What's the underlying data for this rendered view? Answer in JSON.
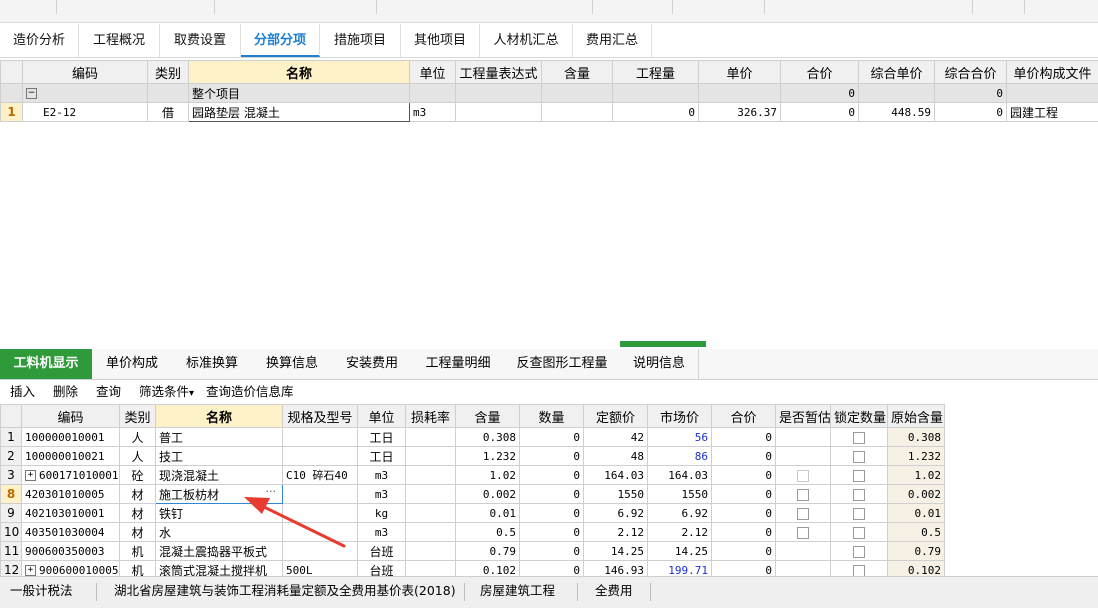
{
  "top_tabs": [
    {
      "label": "造价分析",
      "active": false
    },
    {
      "label": "工程概况",
      "active": false
    },
    {
      "label": "取费设置",
      "active": false
    },
    {
      "label": "分部分项",
      "active": true
    },
    {
      "label": "措施项目",
      "active": false
    },
    {
      "label": "其他项目",
      "active": false
    },
    {
      "label": "人材机汇总",
      "active": false
    },
    {
      "label": "费用汇总",
      "active": false
    }
  ],
  "upper_grid": {
    "columns": [
      "编码",
      "类别",
      "名称",
      "单位",
      "工程量表达式",
      "含量",
      "工程量",
      "单价",
      "合价",
      "综合单价",
      "综合合价",
      "单价构成文件"
    ],
    "group_row": {
      "collapse_symbol": "−",
      "name": "整个项目",
      "hejia": "0",
      "zonghe_hejia": "0"
    },
    "rows": [
      {
        "index": "1",
        "code": "E2-12",
        "type": "借",
        "name": "园路垫层 混凝土",
        "unit": "m3",
        "expr": "",
        "content": "",
        "quantity": "0",
        "price": "326.37",
        "total": "0",
        "comp_price": "448.59",
        "comp_total": "0",
        "file": "园建工程"
      }
    ]
  },
  "bottom_tabs": [
    {
      "label": "工料机显示",
      "active": true
    },
    {
      "label": "单价构成",
      "active": false
    },
    {
      "label": "标准换算",
      "active": false
    },
    {
      "label": "换算信息",
      "active": false
    },
    {
      "label": "安装费用",
      "active": false
    },
    {
      "label": "工程量明细",
      "active": false
    },
    {
      "label": "反查图形工程量",
      "active": false
    },
    {
      "label": "说明信息",
      "active": false
    }
  ],
  "toolbar": {
    "insert": "插入",
    "delete": "删除",
    "query": "查询",
    "filter": "筛选条件",
    "filter_arrow": "▾",
    "query_price": "查询造价信息库"
  },
  "lower_grid": {
    "columns": [
      "编码",
      "类别",
      "名称",
      "规格及型号",
      "单位",
      "损耗率",
      "含量",
      "数量",
      "定额价",
      "市场价",
      "合价",
      "是否暂估",
      "锁定数量",
      "原始含量"
    ],
    "ellipsis": "···",
    "rows": [
      {
        "index": "1",
        "code": "100000010001",
        "type": "人",
        "name": "普工",
        "spec": "",
        "unit": "工日",
        "loss": "",
        "content": "0.308",
        "qty": "0",
        "fixed": "42",
        "market": "56",
        "market_blue": true,
        "total": "0",
        "temp": "",
        "lock": true,
        "orig": "0.308"
      },
      {
        "index": "2",
        "code": "100000010021",
        "type": "人",
        "name": "技工",
        "spec": "",
        "unit": "工日",
        "loss": "",
        "content": "1.232",
        "qty": "0",
        "fixed": "48",
        "market": "86",
        "market_blue": true,
        "total": "0",
        "temp": "",
        "lock": true,
        "orig": "1.232"
      },
      {
        "index": "3",
        "expand": "+",
        "code": "600171010001",
        "type": "砼",
        "name": "现浇混凝土",
        "spec": "C10 碎石40",
        "unit": "m3",
        "loss": "",
        "content": "1.02",
        "qty": "0",
        "fixed": "164.03",
        "market": "164.03",
        "market_blue": false,
        "total": "0",
        "temp": "light",
        "lock": true,
        "orig": "1.02"
      },
      {
        "index": "8",
        "selected": true,
        "code": "420301010005",
        "type": "材",
        "name": "施工板枋材",
        "spec": "",
        "unit": "m3",
        "loss": "",
        "content": "0.002",
        "qty": "0",
        "fixed": "1550",
        "market": "1550",
        "market_blue": false,
        "total": "0",
        "temp": "box",
        "lock": true,
        "orig": "0.002"
      },
      {
        "index": "9",
        "code": "402103010001",
        "type": "材",
        "name": "铁钉",
        "spec": "",
        "unit": "kg",
        "loss": "",
        "content": "0.01",
        "qty": "0",
        "fixed": "6.92",
        "market": "6.92",
        "market_blue": false,
        "total": "0",
        "temp": "box",
        "lock": true,
        "orig": "0.01"
      },
      {
        "index": "10",
        "code": "403501030004",
        "type": "材",
        "name": "水",
        "spec": "",
        "unit": "m3",
        "loss": "",
        "content": "0.5",
        "qty": "0",
        "fixed": "2.12",
        "market": "2.12",
        "market_blue": false,
        "total": "0",
        "temp": "box",
        "lock": true,
        "orig": "0.5"
      },
      {
        "index": "11",
        "code": "900600350003",
        "type": "机",
        "name": "混凝土震捣器平板式",
        "spec": "",
        "unit": "台班",
        "loss": "",
        "content": "0.79",
        "qty": "0",
        "fixed": "14.25",
        "market": "14.25",
        "market_blue": false,
        "total": "0",
        "temp": "",
        "lock": true,
        "orig": "0.79"
      },
      {
        "index": "12",
        "expand": "+",
        "code": "900600010005",
        "type": "机",
        "name": "滚筒式混凝土搅拌机",
        "spec": "500L",
        "unit": "台班",
        "loss": "",
        "content": "0.102",
        "qty": "0",
        "fixed": "146.93",
        "market": "199.71",
        "market_blue": true,
        "total": "0",
        "temp": "",
        "lock": true,
        "orig": "0.102"
      }
    ]
  },
  "status_bar": [
    "一般计税法",
    "湖北省房屋建筑与装饰工程消耗量定额及全费用基价表(2018)",
    "房屋建筑工程",
    "全费用"
  ],
  "colors": {
    "accent_blue": "#1e7fd0",
    "active_green": "#2e9a3a",
    "annotation_red": "#e83a2e"
  }
}
